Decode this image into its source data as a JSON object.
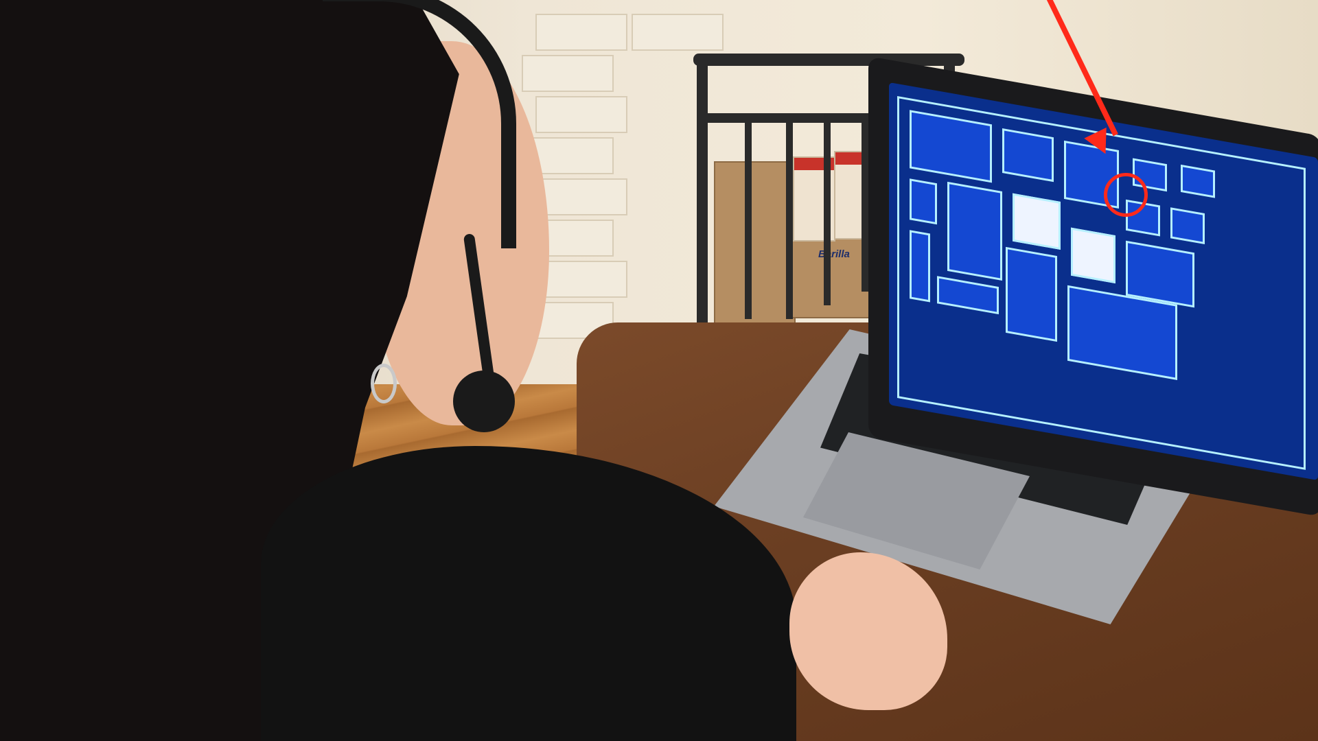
{
  "scene": {
    "packaging": {
      "brand_label": "Barilla"
    },
    "colors": {
      "screen_background": "#0a2f8c",
      "room_fill": "#1448d2",
      "room_outline": "#b6f0ff",
      "annotation": "#ff2a1a"
    },
    "icons": {
      "arrow": "red-arrow-icon",
      "circle": "red-circle-icon"
    }
  }
}
